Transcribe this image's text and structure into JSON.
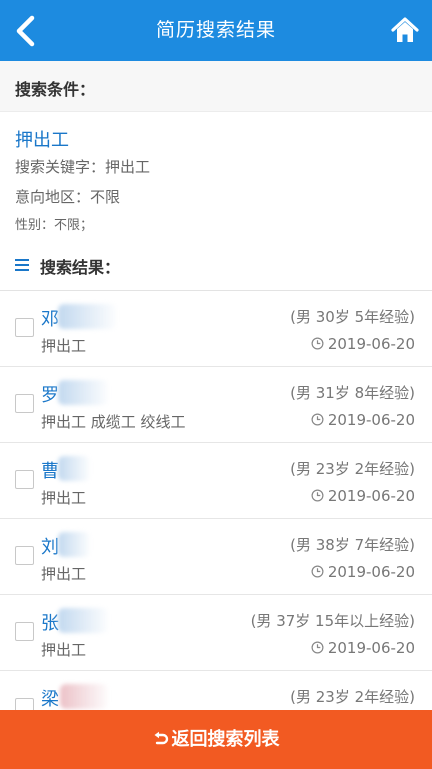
{
  "header": {
    "title": "简历搜索结果",
    "back_icon": "chevron-left-icon",
    "home_icon": "home-icon"
  },
  "conditions": {
    "heading": "搜索条件：",
    "keyword_title": "押出工",
    "keyword_line": "搜索关键字：押出工",
    "region_line": "意向地区：不限",
    "gender_line": "性别：不限；"
  },
  "results": {
    "heading": "搜索结果：",
    "items": [
      {
        "name": "邓",
        "job": "押出工",
        "meta": "(男  30岁  5年经验)",
        "date": "2019-06-20"
      },
      {
        "name": "罗",
        "job": "押出工 成缆工 绞线工",
        "meta": "(男  31岁  8年经验)",
        "date": "2019-06-20"
      },
      {
        "name": "曹",
        "job": "押出工",
        "meta": "(男  23岁  2年经验)",
        "date": "2019-06-20"
      },
      {
        "name": "刘",
        "job": "押出工",
        "meta": "(男  38岁  7年经验)",
        "date": "2019-06-20"
      },
      {
        "name": "张",
        "job": "押出工",
        "meta": "(男  37岁  15年以上经验)",
        "date": "2019-06-20"
      },
      {
        "name": "梁",
        "job": "",
        "meta": "(男  23岁  2年经验)",
        "date": ""
      }
    ]
  },
  "footer": {
    "button_label": "返回搜索列表",
    "icon": "undo-icon"
  },
  "colors": {
    "header_bg": "#1d8be0",
    "link_blue": "#1a77c9",
    "footer_bg": "#f25a22"
  }
}
